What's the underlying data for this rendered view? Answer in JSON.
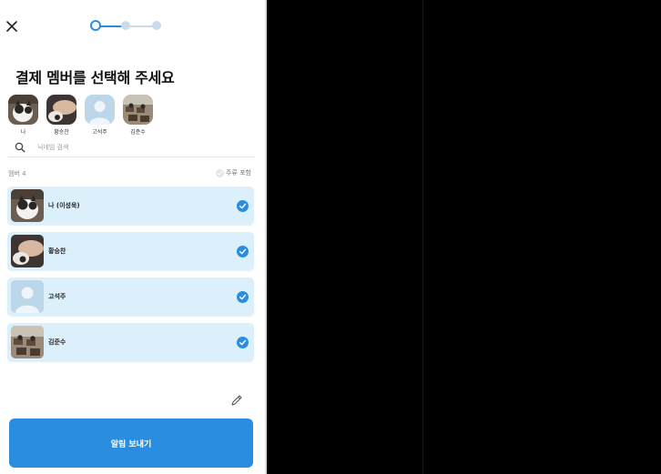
{
  "colors": {
    "accent": "#2b8de0",
    "row_bg": "#dcf0fc",
    "step_inactive": "#c9dcee",
    "background_right": "#000000"
  },
  "header": {
    "close_icon": "close-icon",
    "step_current": 1,
    "step_total": 3
  },
  "title": "결제 멤버를 선택해 주세요",
  "avatars": [
    {
      "label": "나",
      "icon": "cat-photo"
    },
    {
      "label": "황승찬",
      "icon": "hand-photo"
    },
    {
      "label": "고석주",
      "icon": "default-person-icon"
    },
    {
      "label": "김준수",
      "icon": "classroom-photo"
    }
  ],
  "search": {
    "placeholder": "닉네임 검색",
    "value": "",
    "icon": "search-icon"
  },
  "members_header": {
    "count_label": "멤버 4",
    "toggle_label": "주류 포함",
    "toggle_icon": "check-circle-icon"
  },
  "members": [
    {
      "name": "나 (이성욱)",
      "selected": true,
      "icon": "cat-photo"
    },
    {
      "name": "황승찬",
      "selected": true,
      "icon": "hand-photo"
    },
    {
      "name": "고석주",
      "selected": true,
      "icon": "default-person-icon"
    },
    {
      "name": "김준수",
      "selected": true,
      "icon": "classroom-photo"
    }
  ],
  "edit_icon": "pencil-icon",
  "send_button": "알림 보내기"
}
